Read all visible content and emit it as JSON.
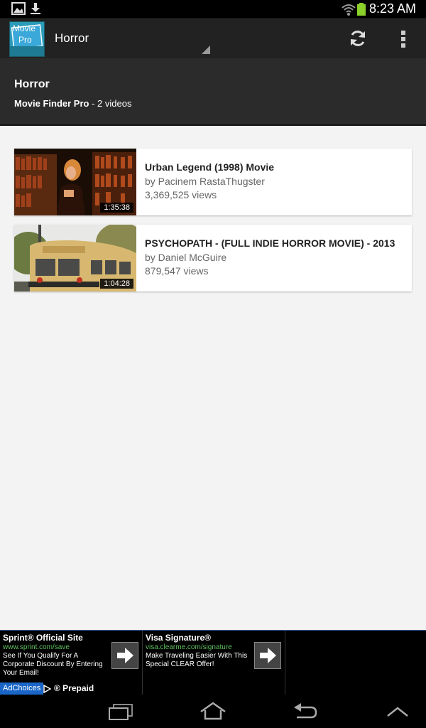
{
  "status_bar": {
    "time": "8:23 AM",
    "left_icons": [
      "image-icon",
      "download-icon"
    ],
    "right_icons": [
      "wifi-icon",
      "battery-icon"
    ]
  },
  "action_bar": {
    "app_icon_text_top": "Movie",
    "app_icon_text_bottom": "Pro",
    "title": "Horror",
    "icons": [
      "refresh-icon",
      "overflow-menu-icon"
    ]
  },
  "header": {
    "title": "Horror",
    "channel": "Movie Finder Pro",
    "count_text": " - 2 videos"
  },
  "videos": [
    {
      "title": "Urban Legend (1998) Movie",
      "author": "by Pacinem RastaThugster",
      "views": "3,369,525 views",
      "duration": "1:35:38"
    },
    {
      "title": "PSYCHOPATH - (FULL INDIE HORROR MOVIE) - 2013",
      "author": "by Daniel McGuire",
      "views": "879,547 views",
      "duration": "1:04:28"
    }
  ],
  "ads": [
    {
      "title": "Sprint® Official Site",
      "url": "www.sprint.com/save",
      "desc": "See If You Qualify For A Corporate Discount By Entering Your Email!"
    },
    {
      "title": "Visa Signature®",
      "url": "visa.clearme.com/signature",
      "desc": "Make Traveling Easier With This Special CLEAR Offer!"
    }
  ],
  "ad_choices": "AdChoices",
  "ad_prepaid": "® Prepaid",
  "nav_bar": {
    "icons": [
      "recent-apps-icon",
      "home-icon",
      "back-icon",
      "up-chevron-icon"
    ]
  }
}
